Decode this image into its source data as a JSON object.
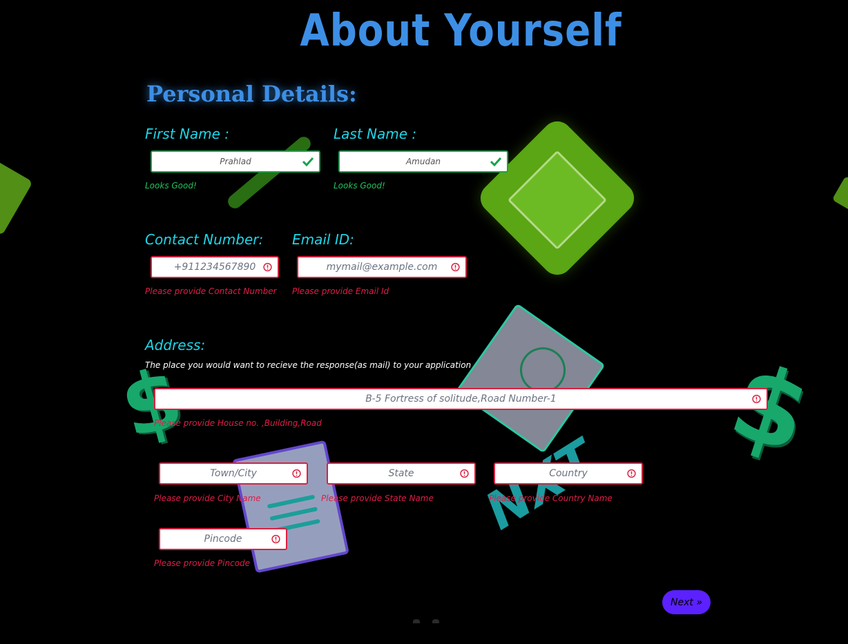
{
  "page": {
    "title": "About Yourself"
  },
  "personal": {
    "section_title": "Personal Details:",
    "first_name": {
      "label": "First Name :",
      "value": "Prahlad",
      "message": "Looks Good!"
    },
    "last_name": {
      "label": "Last Name :",
      "value": "Amudan",
      "message": "Looks Good!"
    },
    "contact": {
      "label": "Contact Number:",
      "placeholder": "+911234567890",
      "message": "Please provide Contact Number"
    },
    "email": {
      "label": "Email ID:",
      "placeholder": "mymail@example.com",
      "message": "Please provide Email Id"
    }
  },
  "address": {
    "label": "Address:",
    "hint": "The place you would want to recieve the response(as mail) to your application",
    "line": {
      "placeholder": "B-5 Fortress of solitude,Road Number-1",
      "message": "Please provide House no. ,Building,Road"
    },
    "city": {
      "placeholder": "Town/City",
      "message": "Please provide City Name"
    },
    "state": {
      "placeholder": "State",
      "message": "Please provide State Name"
    },
    "country": {
      "placeholder": "Country",
      "message": "Please provide Country Name"
    },
    "pincode": {
      "placeholder": "Pincode",
      "message": "Please provide Pincode"
    }
  },
  "nav": {
    "next_label": "Next »"
  },
  "colors": {
    "valid": "#16a34a",
    "invalid": "#dc2040",
    "accent": "#3d8fe5",
    "label": "#1fd6e8",
    "button": "#5b21ff"
  }
}
